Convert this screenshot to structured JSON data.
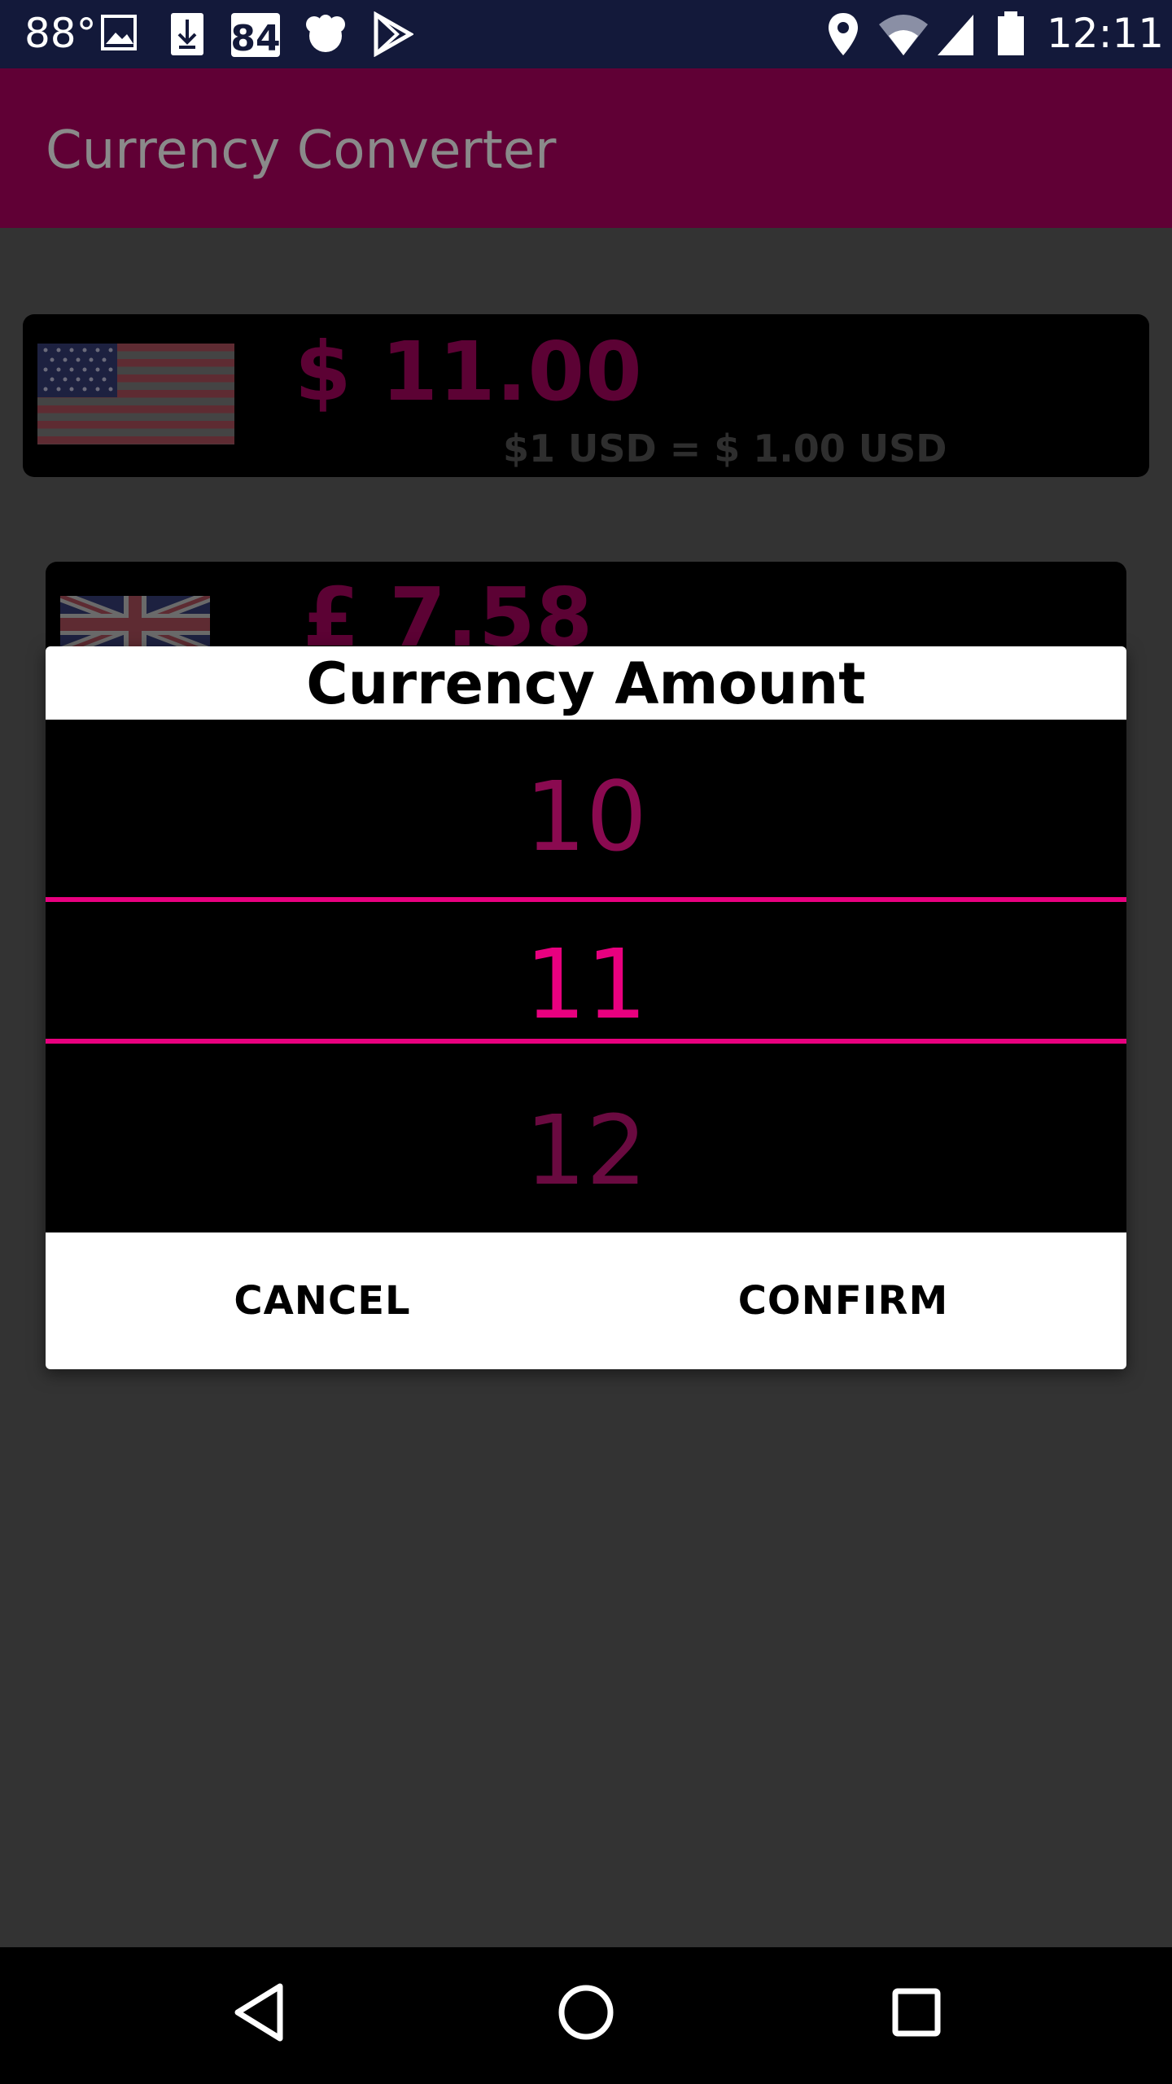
{
  "status_bar": {
    "temperature": "88°",
    "notification_count": "84",
    "time": "12:11",
    "icons": [
      "image-icon",
      "download-icon",
      "badge-84-icon",
      "cloud-icon",
      "play-store-icon",
      "location-icon",
      "wifi-icon",
      "signal-icon",
      "battery-icon"
    ]
  },
  "app_bar": {
    "title": "Currency Converter",
    "color": "#600035"
  },
  "cards": [
    {
      "flag": "us-flag-icon",
      "amount": "$ 11.00",
      "rate": "$1 USD = $ 1.00 USD"
    },
    {
      "flag": "uk-flag-icon",
      "amount": "£ 7.58"
    }
  ],
  "dialog": {
    "title": "Currency Amount",
    "picker": {
      "previous": "10",
      "selected": "11",
      "next": "12"
    },
    "cancel_label": "CANCEL",
    "confirm_label": "CONFIRM",
    "accent": "#e8007f"
  },
  "nav_bar": {
    "icons": [
      "back-icon",
      "home-icon",
      "recents-icon"
    ]
  }
}
